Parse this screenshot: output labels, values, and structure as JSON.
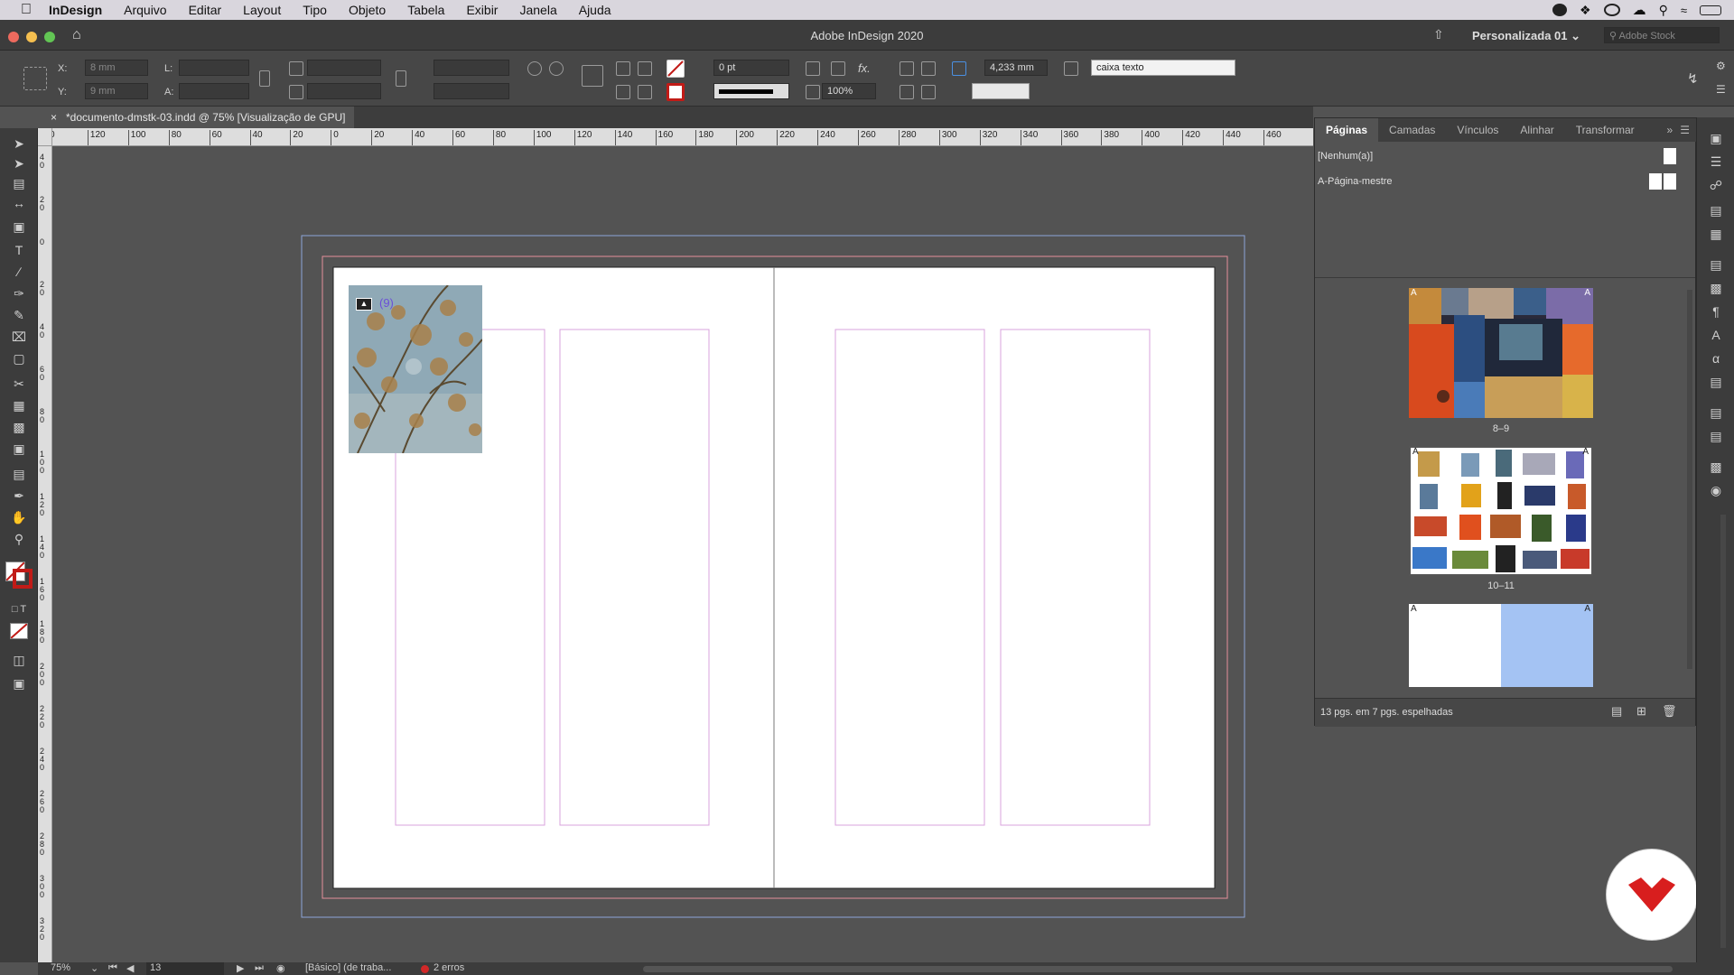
{
  "menubar": {
    "app": "InDesign",
    "items": [
      "Arquivo",
      "Editar",
      "Layout",
      "Tipo",
      "Objeto",
      "Tabela",
      "Exibir",
      "Janela",
      "Ajuda"
    ],
    "status_icons": [
      "record-icon",
      "dropbox-icon",
      "creative-cloud-icon",
      "cloud-icon",
      "search-icon",
      "wifi-icon",
      "battery-icon"
    ]
  },
  "titlebar": {
    "title": "Adobe InDesign 2020",
    "workspace": "Personalizada 01",
    "stock_placeholder": "Adobe Stock"
  },
  "control": {
    "x": "8 mm",
    "y": "9 mm",
    "x_label": "X:",
    "y_label": "Y:",
    "l_label": "L:",
    "a_label": "A:",
    "stroke_weight": "0 pt",
    "scale": "100%",
    "gap": "4,233 mm",
    "style": "caixa texto"
  },
  "document": {
    "tab": "*documento-dmstk-03.indd @ 75% [Visualização de GPU]"
  },
  "ruler": {
    "h_ticks": [
      "0",
      "120",
      "100",
      "80",
      "60",
      "40",
      "20",
      "0",
      "20",
      "40",
      "60",
      "80",
      "100",
      "120",
      "140",
      "160",
      "180",
      "200",
      "220",
      "240",
      "260",
      "280",
      "300",
      "320",
      "340",
      "360",
      "380",
      "400",
      "420",
      "440",
      "460"
    ],
    "v_ticks": [
      "40",
      "20",
      "0",
      "20",
      "40",
      "60",
      "80",
      "100",
      "120",
      "140",
      "160",
      "180",
      "200",
      "220",
      "240",
      "260",
      "280",
      "300",
      "320"
    ]
  },
  "frame": {
    "link_badge": "(9)"
  },
  "panel": {
    "tabs": [
      "Páginas",
      "Camadas",
      "Vínculos",
      "Alinhar",
      "Transformar"
    ],
    "masters": [
      "[Nenhum(a)]",
      "A-Página-mestre"
    ],
    "spreads": [
      "8–9",
      "10–11"
    ],
    "footer": "13 pgs. em 7 pgs. espelhadas",
    "master_letter": "A"
  },
  "status": {
    "zoom": "75%",
    "page": "13",
    "style": "[Básico] (de traba...",
    "errors": "2 erros"
  },
  "colors": {
    "accent": "#c11b17",
    "selected": "#a4c3f3",
    "margin": "#d8a3dd",
    "bleed": "#e58f9b",
    "slug": "#8ea4d8"
  }
}
